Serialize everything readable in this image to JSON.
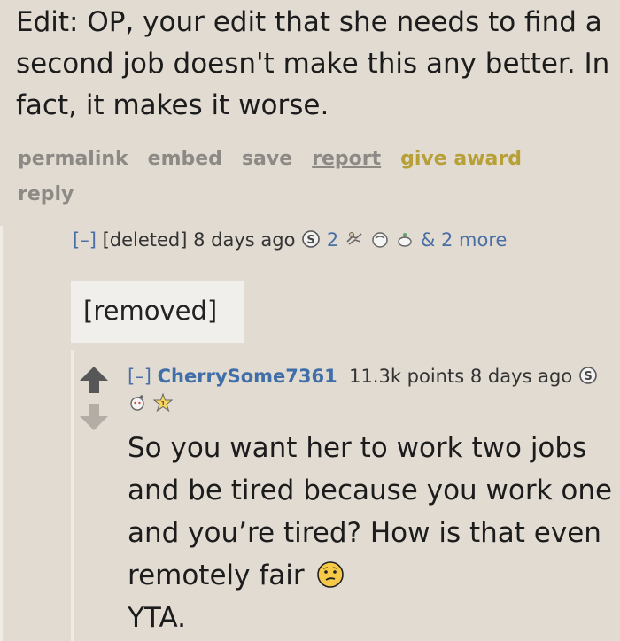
{
  "top_comment": {
    "text": "Edit: OP, your edit that she needs to find a second job doesn't make this any better. In fact, it makes it worse."
  },
  "actions": {
    "permalink": "permalink",
    "embed": "embed",
    "save": "save",
    "report": "report",
    "give_award": "give award",
    "reply": "reply"
  },
  "comment2": {
    "collapse": "[–]",
    "author": "[deleted]",
    "time": "8 days ago",
    "award_count": "2",
    "more": "& 2 more",
    "body": "[removed]"
  },
  "comment3": {
    "collapse": "[–]",
    "author": "CherrySome7361",
    "points": "11.3k points",
    "time_part1": "8 days",
    "time_part2": "ago",
    "body": "So you want her to work two jobs and be tired because you work one and you’re tired? How is that even remotely fair",
    "body_end": "YTA."
  },
  "colors": {
    "background": "#e1dbd2",
    "link_blue": "#4a6fa5",
    "award_gold": "#b7a038",
    "action_gray": "#8d8a86"
  },
  "icons": [
    "silver-award-icon",
    "helping-hand-icon",
    "facepalm-icon",
    "wholesome-icon",
    "upvote-arrow-icon",
    "downvote-arrow-icon",
    "thinking-face-emoji-icon"
  ]
}
